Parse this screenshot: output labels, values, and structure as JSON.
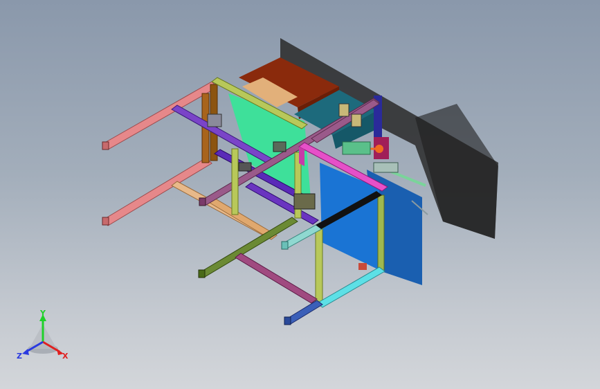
{
  "viewport": {
    "background_top": "#8a98ab",
    "background_bottom": "#d3d6da"
  },
  "model": {
    "frame_colors": [
      "#e6888a",
      "#e8b98a",
      "#7a44c8",
      "#b8c85a",
      "#9fdc7a",
      "#6b8a34",
      "#c84a86",
      "#3b5fb8",
      "#5de0e6",
      "#e650c8",
      "#111111"
    ],
    "panel_colors": {
      "green_panel": "#3ee09a",
      "brown_box": "#8a2a0c",
      "teal_box": "#1d6a7c",
      "blue_panel": "#1a74d4",
      "shadow": "#2a2a2a"
    }
  },
  "triad": {
    "y_label": "Y",
    "x_label": "X",
    "z_label": "Z",
    "y_color": "#1fd12a",
    "x_color": "#e02020",
    "z_color": "#2a3ae0"
  }
}
